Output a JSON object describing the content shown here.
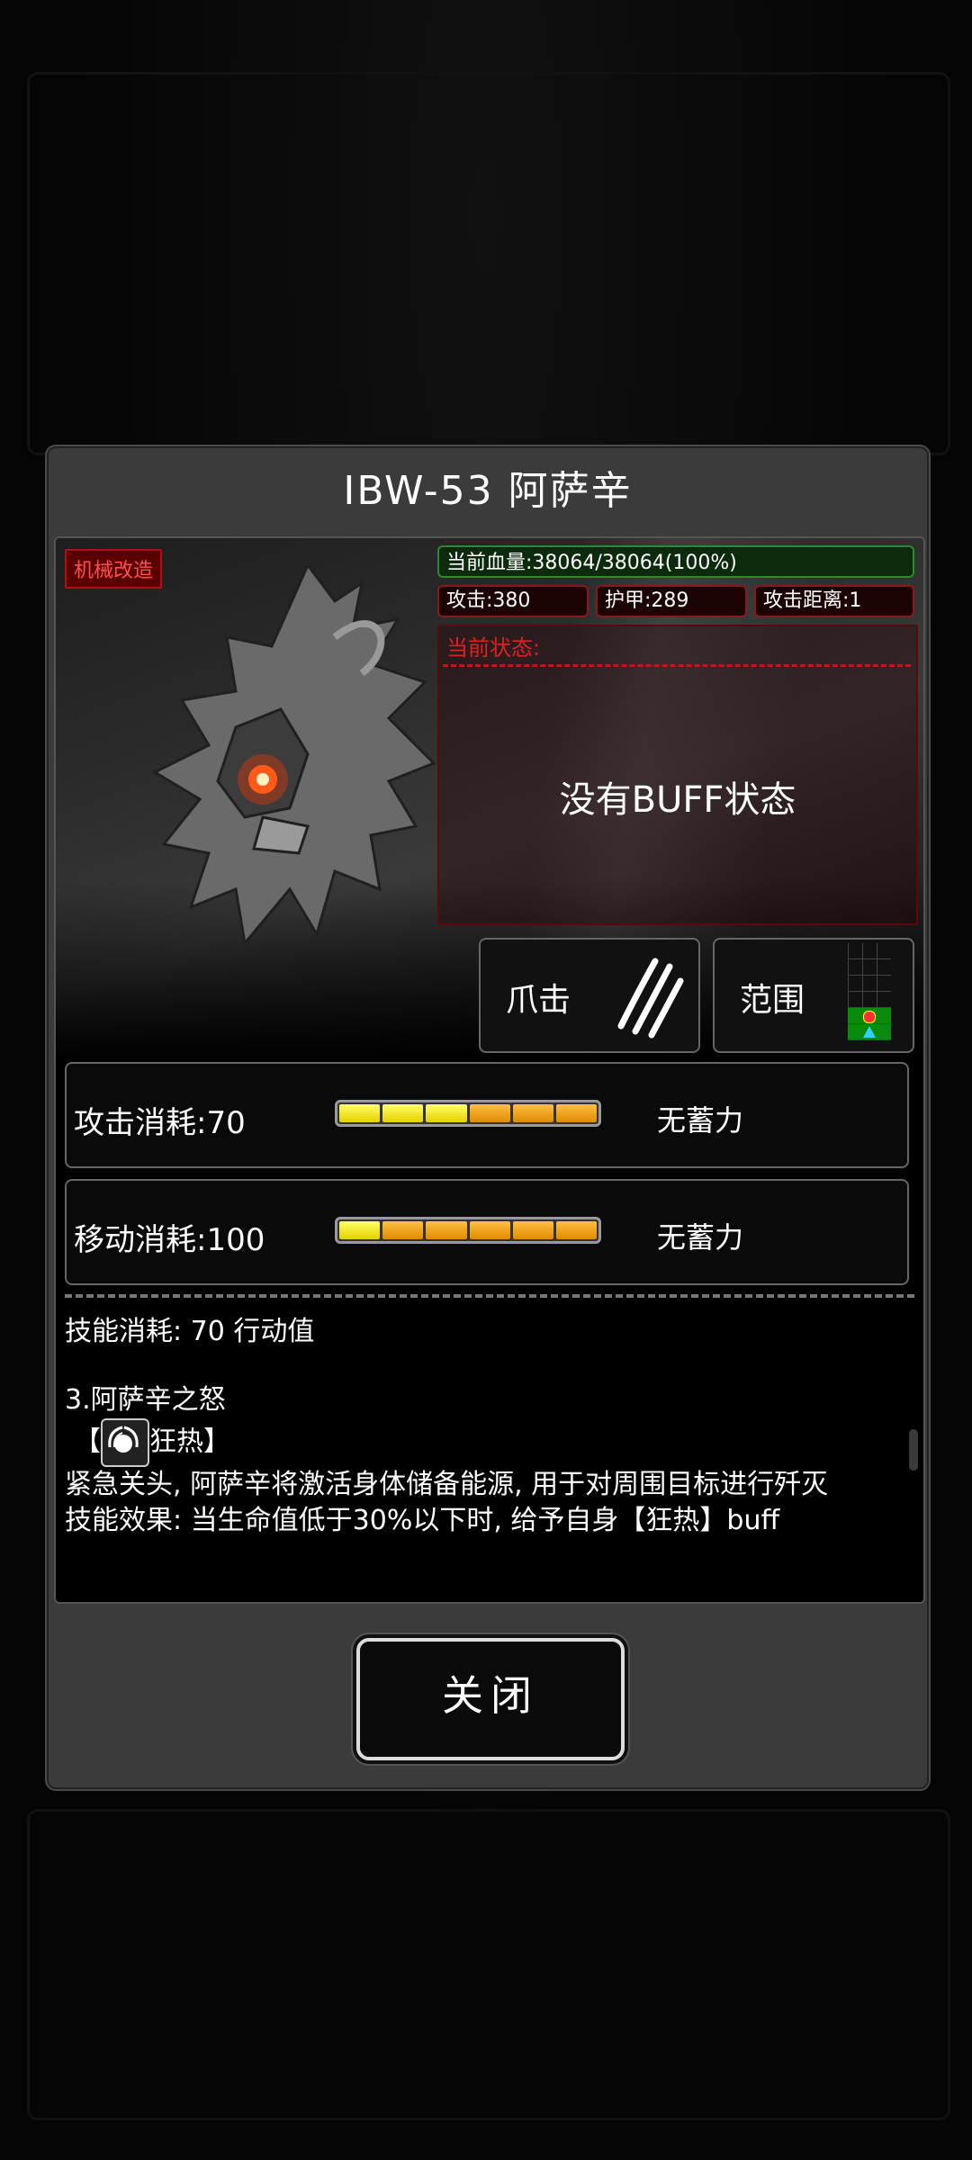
{
  "dialog": {
    "title": "IBW-53 阿萨辛",
    "tag": "机械改造",
    "hp": "当前血量:38064/38064(100%)",
    "stats": {
      "attack": "攻击:380",
      "armor": "护甲:289",
      "range": "攻击距离:1"
    },
    "status": {
      "label": "当前状态:",
      "empty_text": "没有BUFF状态"
    },
    "attack_type": {
      "label": "爪击",
      "icon": "claw-slash-icon"
    },
    "range_card": {
      "label": "范围",
      "icon": "range-grid-icon"
    },
    "costs": [
      {
        "label": "攻击消耗:70",
        "note": "无蓄力",
        "filled_segments": 3,
        "total_segments": 6
      },
      {
        "label": "移动消耗:100",
        "note": "无蓄力",
        "filled_segments": 1,
        "total_segments": 6
      }
    ],
    "description": {
      "line1": "技能消耗: 70 行动值",
      "skill_title": "3.阿萨辛之怒",
      "buff_open": "【",
      "buff_name": "狂热】",
      "buff_icon": "frenzy-buff-icon",
      "line2": "紧急关头, 阿萨辛将激活身体储备能源, 用于对周围目标进行歼灭",
      "line3": "技能效果: 当生命值低于30%以下时, 给予自身【狂热】buff"
    },
    "close_label": "关闭"
  },
  "colors": {
    "hp_border": "#2b8a2b",
    "stat_border": "#8a1a1a",
    "status_label": "#e02020",
    "segment_yellow": "#ffff33",
    "segment_orange": "#f0a000"
  }
}
